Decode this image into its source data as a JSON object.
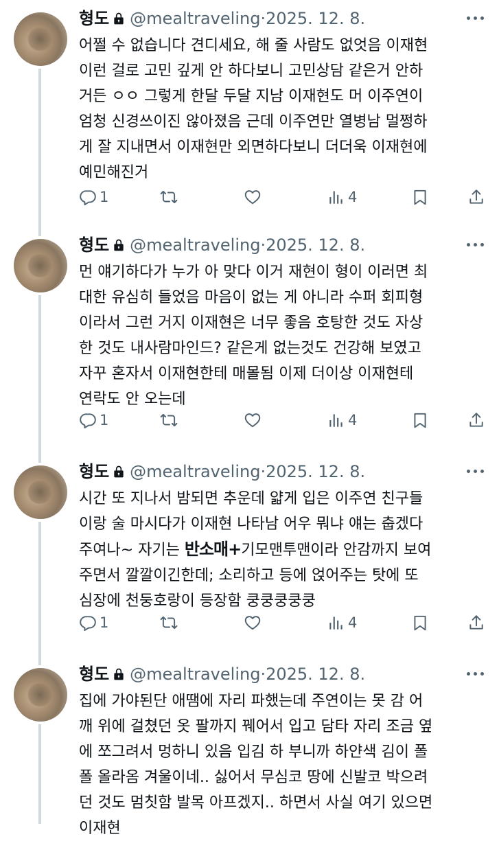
{
  "tweets": [
    {
      "name": "형도",
      "handle": "@mealtraveling",
      "sep": "·",
      "date": "2025. 12. 8.",
      "text": "어쩔 수 없습니다 견디세요, 해 줄 사람도 없엇음 이재현\n이런 걸로 고민 깊게 안 하다보니 고민상담 같은거 안하\n거든 ㅇㅇ 그렇게 한달 두달 지남 이재현도 머 이주연이\n엄청 신경쓰이진 않아졌음 근데 이주연만 열병남 멀쩡하\n게 잘 지내면서 이재현만 외면하다보니 더더욱 이재현에\n예민해진거",
      "replies": "1",
      "views": "4"
    },
    {
      "name": "형도",
      "handle": "@mealtraveling",
      "sep": "·",
      "date": "2025. 12. 8.",
      "text": "먼 얘기하다가 누가 아 맞다 이거 재현이 형이 이러면 최\n대한 유심히 들었음 마음이 없는 게 아니라 수퍼 회피형\n이라서 그런 거지 이재현은 너무 좋음 호탕한 것도 자상\n한 것도 내사람마인드? 같은게 없는것도 건강해 보였고\n자꾸 혼자서 이재현한테 매몰됨 이제 더이상 이재현테\n연락도 안 오는데",
      "replies": "1",
      "views": "4"
    },
    {
      "name": "형도",
      "handle": "@mealtraveling",
      "sep": "·",
      "date": "2025. 12. 8.",
      "text_a": "시간 또 지나서 밤되면 추운데 얇게 입은 이주연 친구들\n이랑 술 마시다가 이재현 나타남 어우 뭐냐 얘는 춥겠다\n주여나~ 자기는 ",
      "sticker": "반소매+",
      "text_b": "기모맨투맨이라 안감까지 보여\n주면서 깔깔이긴한데; 소리하고 등에 얹어주는 탓에 또\n심장에 천둥호랑이 등장함 쿵쿵쿵쿵쿵",
      "replies": "1",
      "views": "4"
    },
    {
      "name": "형도",
      "handle": "@mealtraveling",
      "sep": "·",
      "date": "2025. 12. 8.",
      "text": "집에 가야된단 애땜에 자리 파했는데 주연이는 못 감 어\n깨 위에 걸쳤던 옷 팔까지 꿰어서 입고 담타 자리 조금 옆\n에 쪼그려서 멍하니 있음 입김 하 부니까 하얀색 김이 폴\n폴 올라옴 겨울이네.. 싫어서 무심코 땅에 신발코 박으려\n던 것도 멈칫함 발목 아프겠지.. 하면서 사실 여기 있으면\n이재현"
    }
  ]
}
